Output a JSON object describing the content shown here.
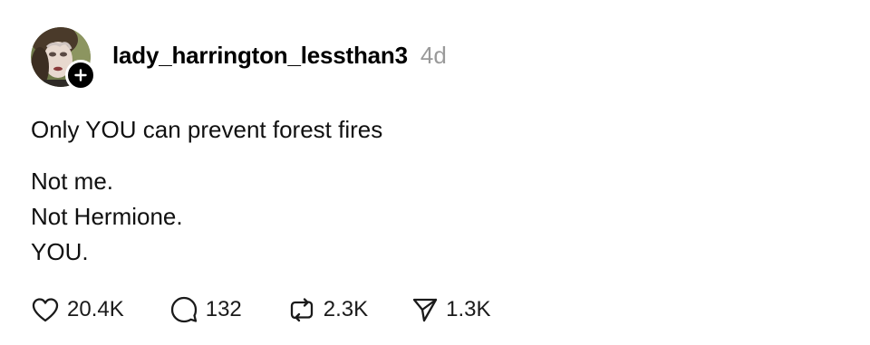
{
  "post": {
    "author": {
      "username": "lady_harrington_lessthan3",
      "avatar_icon": "user-avatar",
      "follow_icon": "plus-icon"
    },
    "timestamp": "4d",
    "body": {
      "paragraphs": [
        {
          "lines": [
            "Only YOU can prevent forest fires"
          ]
        },
        {
          "lines": [
            "Not me.",
            "Not Hermione.",
            "YOU."
          ]
        }
      ]
    },
    "actions": {
      "like": {
        "icon": "heart-icon",
        "count": "20.4K"
      },
      "reply": {
        "icon": "comment-icon",
        "count": "132"
      },
      "repost": {
        "icon": "repost-icon",
        "count": "2.3K"
      },
      "share": {
        "icon": "send-icon",
        "count": "1.3K"
      }
    }
  },
  "colors": {
    "text": "#101010",
    "muted": "#9a9a9a",
    "badge": "#000000",
    "background": "#ffffff"
  }
}
